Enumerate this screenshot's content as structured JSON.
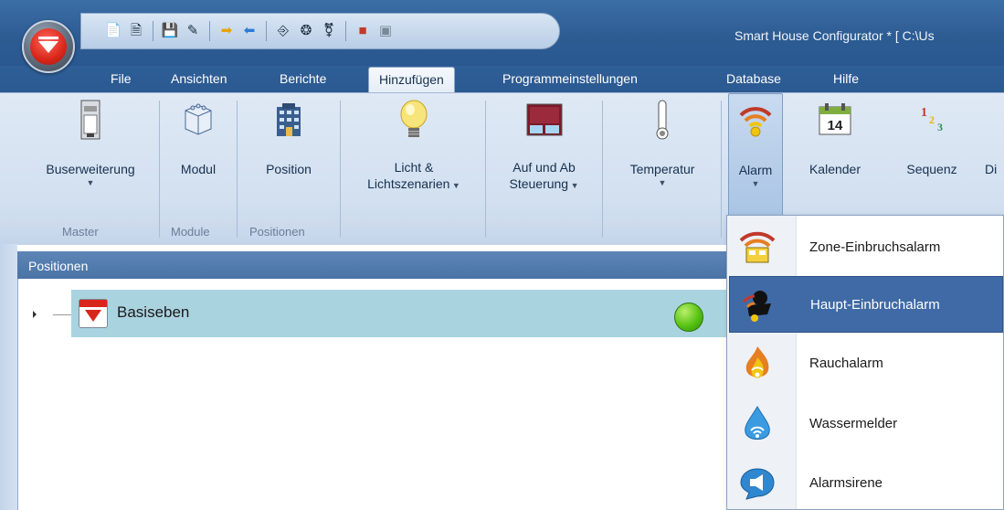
{
  "window": {
    "title": "Smart House Configurator * [ C:\\Us"
  },
  "menu_tabs": [
    {
      "label": "File"
    },
    {
      "label": "Ansichten"
    },
    {
      "label": "Berichte"
    },
    {
      "label": "Hinzufügen",
      "active": true
    },
    {
      "label": "Programmeinstellungen"
    },
    {
      "label": "Database"
    },
    {
      "label": "Hilfe"
    }
  ],
  "ribbon": {
    "buttons": {
      "buserweiterung": {
        "label": "Buserweiterung",
        "icon": "module-rail-icon"
      },
      "modul": {
        "label": "Modul",
        "icon": "cube-icon"
      },
      "position": {
        "label": "Position",
        "icon": "building-icon"
      },
      "licht_l1": "Licht &",
      "licht_l2": "Lichtszenarien",
      "aufab_l1": "Auf und Ab",
      "aufab_l2": "Steuerung",
      "temperatur": {
        "label": "Temperatur",
        "icon": "thermometer-icon"
      },
      "alarm": {
        "label": "Alarm",
        "icon": "alarm-icon"
      },
      "kalender": {
        "label": "Kalender",
        "icon": "calendar-icon",
        "day": "14"
      },
      "sequenz": {
        "label": "Sequenz",
        "icon": "sequence-icon"
      },
      "cut": "Di"
    },
    "groups": {
      "master": "Master",
      "module": "Module",
      "positionen": "Positionen"
    }
  },
  "panel": {
    "title": "Positionen",
    "tree": [
      {
        "label": "Basiseben",
        "status_color": "#58c214"
      }
    ]
  },
  "alarm_menu": {
    "items": [
      {
        "label": "Zone-Einbruchsalarm",
        "icon": "zone-alarm-icon"
      },
      {
        "label": "Haupt-Einbruchalarm",
        "icon": "intruder-alarm-icon",
        "selected": true
      },
      {
        "label": "Rauchalarm",
        "icon": "smoke-alarm-icon"
      },
      {
        "label": "Wassermelder",
        "icon": "water-alarm-icon"
      },
      {
        "label": "Alarmsirene",
        "icon": "siren-icon"
      }
    ]
  },
  "colors": {
    "titlebar": "#2d5c93",
    "ribbon": "#d2e0f0",
    "selected_item": "#3f6aa5",
    "tree_highlight": "#aad3e0",
    "brand_red": "#d9261a"
  }
}
